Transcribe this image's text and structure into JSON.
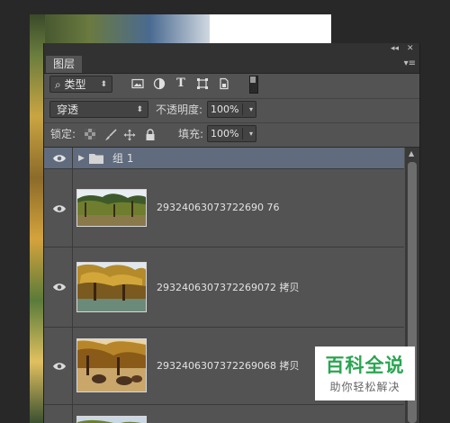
{
  "panel": {
    "tab_label": "图层",
    "collapse_glyph": "◂◂",
    "close_glyph": "✕",
    "menu_glyph": "▾≡"
  },
  "filter": {
    "kind_label": "⌕ 类型",
    "arrow": "⬍",
    "icons": [
      "image-icon",
      "adjustment-icon",
      "type-icon",
      "shape-icon",
      "smart-object-icon"
    ],
    "type_icon_glyph": "T"
  },
  "blend": {
    "mode": "穿透",
    "arrow": "⬍",
    "opacity_label": "不透明度:",
    "opacity_value": "100%",
    "value_arrow": "▾"
  },
  "lock": {
    "label": "锁定:",
    "fill_label": "填充:",
    "fill_value": "100%",
    "value_arrow": "▾"
  },
  "layers": {
    "group_name": "组 1",
    "group_arrow": "▶",
    "eye_glyph": "👁",
    "items": [
      {
        "name": "29324063073722690 76"
      },
      {
        "name": "2932406307372269072 拷贝"
      },
      {
        "name": "2932406307372269068 拷贝"
      }
    ]
  },
  "scrollbar": {
    "arrow": "▲"
  },
  "watermark": {
    "main": "百科全说",
    "sub": "助你轻松解决"
  }
}
